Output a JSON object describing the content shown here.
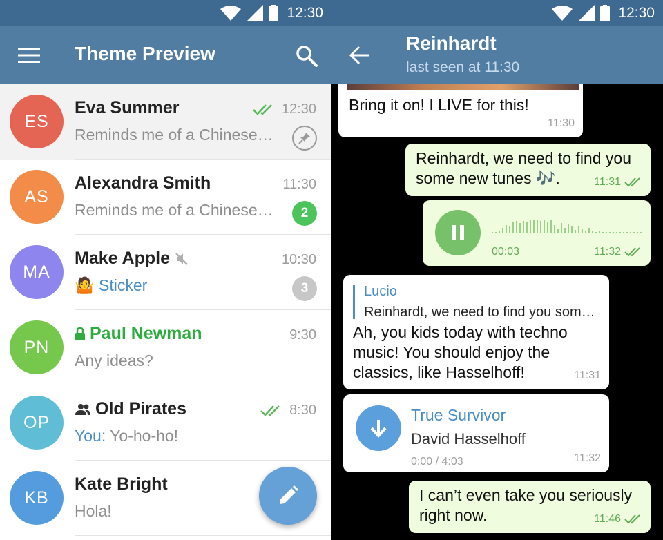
{
  "status_bar": {
    "time": "12:30",
    "icons": [
      "wifi-icon",
      "signal-icon",
      "battery-icon"
    ]
  },
  "chat_list": {
    "title": "Theme Preview",
    "icons": [
      "menu-icon",
      "search-icon",
      "pencil-icon"
    ],
    "chats": [
      {
        "initials": "ES",
        "avatar_color": "#e56555",
        "name": "Eva Summer",
        "time": "12:30",
        "preview": "Reminds me of a Chinese prove…",
        "read": true,
        "pinned": true
      },
      {
        "initials": "AS",
        "avatar_color": "#f28c48",
        "name": "Alexandra Smith",
        "time": "11:30",
        "preview": "Reminds me of a Chinese prove…",
        "unread": "2",
        "badge_color": "#4bc45c"
      },
      {
        "initials": "MA",
        "avatar_color": "#8e85ee",
        "name": "Make Apple",
        "time": "10:30",
        "preview": "Sticker",
        "sticker_emoji": "🤷",
        "muted": true,
        "unread": "3",
        "badge_color": "#c7c7c7"
      },
      {
        "initials": "PN",
        "avatar_color": "#76c84d",
        "name": "Paul Newman",
        "time": "9:30",
        "preview": "Any ideas?",
        "secret": true
      },
      {
        "initials": "OP",
        "avatar_color": "#5fbed5",
        "name": "Old Pirates",
        "time": "8:30",
        "sender": "You:",
        "preview": " Yo-ho-ho!",
        "group": true,
        "read": true
      },
      {
        "initials": "KB",
        "avatar_color": "#549cdd",
        "name": "Kate Bright",
        "time": "",
        "preview": "Hola!"
      }
    ]
  },
  "chat_view": {
    "name": "Reinhardt",
    "status": "last seen at 11:30",
    "icons": [
      "back-arrow-icon"
    ],
    "messages": [
      {
        "type": "text",
        "direction": "in",
        "text": "Bring it on! I LIVE for this!",
        "time": "11:30"
      },
      {
        "type": "text",
        "direction": "out",
        "text": "Reinhardt, we need to find you some new tunes 🎶.",
        "time": "11:31",
        "read": true
      },
      {
        "type": "voice",
        "direction": "out",
        "duration": "00:03",
        "time": "11:32",
        "read": true
      },
      {
        "type": "reply",
        "direction": "in",
        "reply_name": "Lucio",
        "reply_text": "Reinhardt, we need to find you some new tunes 🎶.",
        "text": "Ah, you kids today with techno music! You should enjoy the classics, like Hasselhoff!",
        "time": "11:31"
      },
      {
        "type": "music",
        "direction": "in",
        "title": "True Survivor",
        "artist": "David Hasselhoff",
        "duration": "0:00 / 4:03",
        "time": "11:32"
      },
      {
        "type": "text",
        "direction": "out",
        "text": "I can’t even take you seriously right now.",
        "time": "11:46",
        "read": true
      }
    ]
  },
  "colors": {
    "header": "#517da2",
    "status_bar": "#3e6a91",
    "accent": "#4a8ec7",
    "outgoing_bubble": "#effdde",
    "check": "#62ac55"
  }
}
